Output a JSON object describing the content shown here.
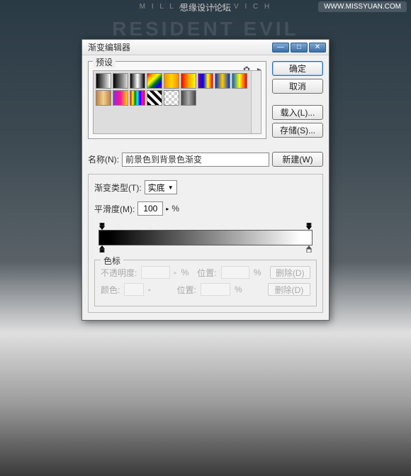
{
  "watermark": {
    "brand": "思缘设计论坛",
    "site": "WWW.MISSYUAN.COM"
  },
  "poster": {
    "subtitle": "M I L L A   J O V O V I C H",
    "title": "RESIDENT EVIL"
  },
  "dialog": {
    "title": "渐变编辑器",
    "presets_label": "预设",
    "ok": "确定",
    "cancel": "取消",
    "load": "载入(L)...",
    "save": "存储(S)...",
    "new": "新建(W)",
    "name_label": "名称(N):",
    "name_value": "前景色到背景色渐变",
    "type_label": "渐变类型(T):",
    "type_value": "实底",
    "smooth_label": "平滑度(M):",
    "smooth_value": "100",
    "percent": "%",
    "stops_label": "色标",
    "opacity_label": "不透明度:",
    "position_label": "位置:",
    "color_label": "颜色:",
    "delete": "删除(D)"
  },
  "chart_data": {
    "type": "gradient",
    "opacity_stops": [
      {
        "position": 0,
        "opacity": 100
      },
      {
        "position": 100,
        "opacity": 100
      }
    ],
    "color_stops": [
      {
        "position": 0,
        "color": "#000000"
      },
      {
        "position": 100,
        "color": "#ffffff"
      }
    ]
  }
}
